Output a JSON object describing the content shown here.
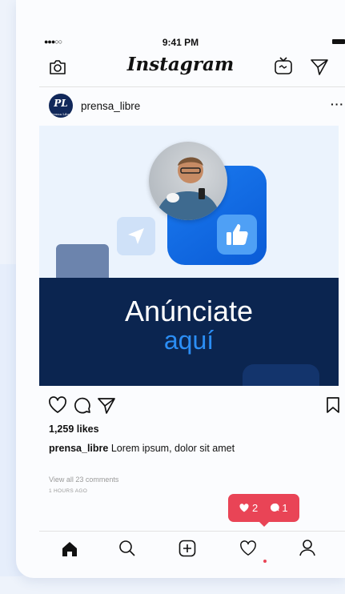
{
  "status": {
    "time": "9:41 PM",
    "signal": "●●●○○"
  },
  "header": {
    "brand": "Instagram",
    "icons": [
      "camera-icon",
      "igtv-icon",
      "direct-icon"
    ]
  },
  "post": {
    "username": "prensa_libre",
    "avatar_text": "PL",
    "avatar_small": "Prensa Libre",
    "more": "···",
    "image": {
      "headline": "Anúnciate",
      "subline": "aquí"
    },
    "likes": "1,259 likes",
    "caption_user": "prensa_libre",
    "caption_text": "Lorem ipsum, dolor sit amet",
    "comments_link": "View all 23 comments",
    "time_ago": "1 HOURS AGO"
  },
  "notification": {
    "likes": "2",
    "comments": "1"
  },
  "colors": {
    "accent": "#0a5bd6",
    "band": "#0b2550",
    "notification": "#e94456"
  },
  "tabbar": [
    "home-icon",
    "search-icon",
    "add-icon",
    "activity-icon",
    "profile-icon"
  ]
}
